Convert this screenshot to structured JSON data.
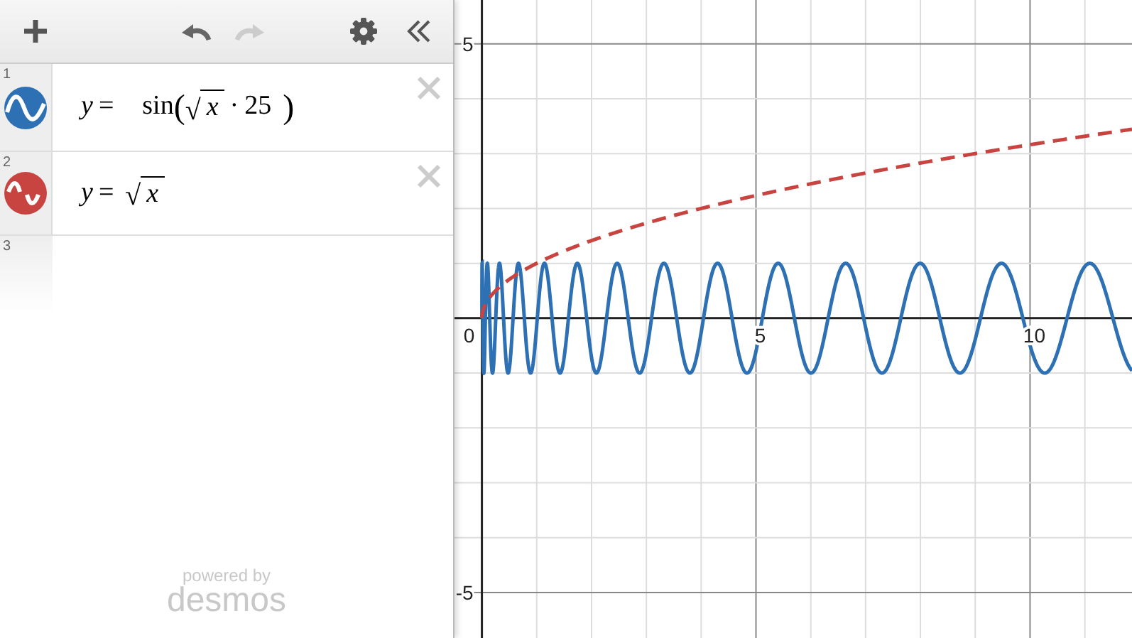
{
  "toolbar": {
    "redo_disabled": true
  },
  "expressions": [
    {
      "number": "1",
      "color": "#2d70b3",
      "kind": "sine_of_root",
      "tokens": [
        {
          "kind": "text",
          "text": "y ="
        },
        {
          "kind": "func",
          "text": "sin"
        },
        {
          "kind": "paren",
          "text": "("
        },
        {
          "kind": "sqrt",
          "sign": "√",
          "text": "x"
        },
        {
          "kind": "text",
          "text": "· 25"
        },
        {
          "kind": "paren",
          "text": ")"
        }
      ]
    },
    {
      "number": "2",
      "color": "#c74440",
      "kind": "root",
      "tokens": [
        {
          "kind": "text",
          "text": "y ="
        },
        {
          "kind": "sqrt",
          "sign": "√",
          "text": "x"
        }
      ]
    }
  ],
  "empty_row": {
    "number": "3"
  },
  "branding": {
    "line1": "powered by",
    "line2": "desmos"
  },
  "graph": {
    "x_labels": [
      "0",
      "5",
      "10"
    ],
    "y_labels": [
      "5",
      "-5"
    ]
  }
}
